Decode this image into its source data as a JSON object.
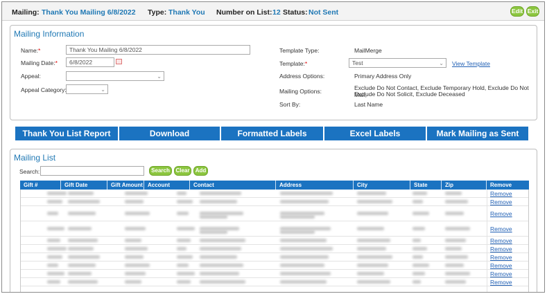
{
  "header": {
    "mailing_label": "Mailing:",
    "mailing_value": "Thank You Mailing 6/8/2022",
    "type_label": "Type:",
    "type_value": "Thank You",
    "count_label": "Number on List:",
    "count_value": "12",
    "status_label": "Status:",
    "status_value": "Not Sent",
    "edit_button": "Edit",
    "exit_button": "Exit"
  },
  "info": {
    "title": "Mailing Information",
    "name_label": "Name:",
    "name_value": "Thank You Mailing 6/8/2022",
    "date_label": "Mailing Date:",
    "date_value": "6/8/2022",
    "appeal_label": "Appeal:",
    "appeal_value": "",
    "appeal_category_label": "Appeal Category:",
    "appeal_category_value": "",
    "template_type_label": "Template Type:",
    "template_type_value": "MailMerge",
    "template_label": "Template:",
    "template_value": "Test",
    "view_template_link": "View Template",
    "address_options_label": "Address Options:",
    "address_options_value": "Primary Address Only",
    "mailing_options_label": "Mailing Options:",
    "mailing_options_value_1": "Exclude Do Not Contact, Exclude Temporary Hold, Exclude Do Not Mail,",
    "mailing_options_value_2": "Exclude Do Not Solicit, Exclude Deceased",
    "sort_by_label": "Sort By:",
    "sort_by_value": "Last Name"
  },
  "actions": {
    "thank_you_report": "Thank You List Report",
    "download": "Download",
    "formatted_labels": "Formatted Labels",
    "excel_labels": "Excel Labels",
    "mark_sent": "Mark Mailing as Sent"
  },
  "list": {
    "title": "Mailing List",
    "search_label": "Search:",
    "search_value": "",
    "search_button": "Search",
    "clear_button": "Clear",
    "add_button": "Add",
    "columns": [
      "Gift #",
      "Gift Date",
      "Gift Amount",
      "Account",
      "Contact",
      "Address",
      "City",
      "State",
      "Zip",
      "Remove"
    ],
    "remove_link": "Remove",
    "row_count": 10
  },
  "colors": {
    "accent_blue": "#1b73c1",
    "link_blue": "#1f5fb4",
    "header_text_blue": "#1f78b4",
    "button_green": "#8cc63f",
    "required_red": "#dd0000"
  }
}
